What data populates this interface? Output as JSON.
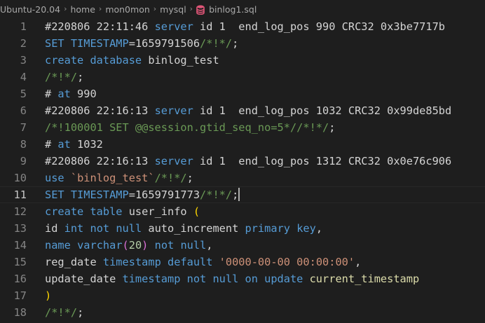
{
  "breadcrumb": {
    "items": [
      "Ubuntu-20.04",
      "home",
      "mon0mon",
      "mysql"
    ],
    "separator": "›",
    "file": "binlog1.sql",
    "file_icon": "database-icon"
  },
  "editor": {
    "current_line": 11,
    "lines": [
      {
        "number": "1",
        "tokens": [
          {
            "t": "#220806 22:11:46 ",
            "c": "plain"
          },
          {
            "t": "server",
            "c": "keyword"
          },
          {
            "t": " id 1  end_log_pos 990 CRC32 0x3be7717b",
            "c": "plain"
          }
        ]
      },
      {
        "number": "2",
        "tokens": [
          {
            "t": "SET TIMESTAMP",
            "c": "keyword"
          },
          {
            "t": "=1659791506",
            "c": "plain"
          },
          {
            "t": "/*!*/",
            "c": "comment"
          },
          {
            "t": ";",
            "c": "plain"
          }
        ]
      },
      {
        "number": "3",
        "tokens": [
          {
            "t": "create database",
            "c": "keyword"
          },
          {
            "t": " binlog_test",
            "c": "plain"
          }
        ]
      },
      {
        "number": "4",
        "tokens": [
          {
            "t": "/*!*/",
            "c": "comment"
          },
          {
            "t": ";",
            "c": "plain"
          }
        ]
      },
      {
        "number": "5",
        "tokens": [
          {
            "t": "# ",
            "c": "plain"
          },
          {
            "t": "at",
            "c": "keyword"
          },
          {
            "t": " 990",
            "c": "plain"
          }
        ]
      },
      {
        "number": "6",
        "tokens": [
          {
            "t": "#220806 22:16:13 ",
            "c": "plain"
          },
          {
            "t": "server",
            "c": "keyword"
          },
          {
            "t": " id 1  end_log_pos 1032 CRC32 0x99de85bd",
            "c": "plain"
          }
        ]
      },
      {
        "number": "7",
        "tokens": [
          {
            "t": "/*!100001 SET @@session.gtid_seq_no=5*//*!*/",
            "c": "comment"
          },
          {
            "t": ";",
            "c": "plain"
          }
        ]
      },
      {
        "number": "8",
        "tokens": [
          {
            "t": "# ",
            "c": "plain"
          },
          {
            "t": "at",
            "c": "keyword"
          },
          {
            "t": " 1032",
            "c": "plain"
          }
        ]
      },
      {
        "number": "9",
        "tokens": [
          {
            "t": "#220806 22:16:13 ",
            "c": "plain"
          },
          {
            "t": "server",
            "c": "keyword"
          },
          {
            "t": " id 1  end_log_pos 1312 CRC32 0x0e76c906",
            "c": "plain"
          }
        ]
      },
      {
        "number": "10",
        "tokens": [
          {
            "t": "use",
            "c": "keyword"
          },
          {
            "t": " ",
            "c": "plain"
          },
          {
            "t": "`binlog_test`",
            "c": "string"
          },
          {
            "t": "/*!*/",
            "c": "comment"
          },
          {
            "t": ";",
            "c": "plain"
          }
        ]
      },
      {
        "number": "11",
        "tokens": [
          {
            "t": "SET TIMESTAMP",
            "c": "keyword"
          },
          {
            "t": "=1659791773",
            "c": "plain"
          },
          {
            "t": "/*!*/",
            "c": "comment"
          },
          {
            "t": ";",
            "c": "plain"
          }
        ]
      },
      {
        "number": "12",
        "tokens": [
          {
            "t": "create table",
            "c": "keyword"
          },
          {
            "t": " user_info ",
            "c": "plain"
          },
          {
            "t": "(",
            "c": "paren2"
          }
        ]
      },
      {
        "number": "13",
        "tokens": [
          {
            "t": "id ",
            "c": "plain"
          },
          {
            "t": "int not null",
            "c": "keyword"
          },
          {
            "t": " auto_increment ",
            "c": "plain"
          },
          {
            "t": "primary key",
            "c": "keyword"
          },
          {
            "t": ",",
            "c": "plain"
          }
        ]
      },
      {
        "number": "14",
        "tokens": [
          {
            "t": "name",
            "c": "keyword"
          },
          {
            "t": " ",
            "c": "plain"
          },
          {
            "t": "varchar",
            "c": "keyword"
          },
          {
            "t": "(",
            "c": "paren"
          },
          {
            "t": "20",
            "c": "number"
          },
          {
            "t": ")",
            "c": "paren"
          },
          {
            "t": " ",
            "c": "plain"
          },
          {
            "t": "not null",
            "c": "keyword"
          },
          {
            "t": ",",
            "c": "plain"
          }
        ]
      },
      {
        "number": "15",
        "tokens": [
          {
            "t": "reg_date ",
            "c": "plain"
          },
          {
            "t": "timestamp default",
            "c": "keyword"
          },
          {
            "t": " ",
            "c": "plain"
          },
          {
            "t": "'0000-00-00 00:00:00'",
            "c": "string"
          },
          {
            "t": ",",
            "c": "plain"
          }
        ]
      },
      {
        "number": "16",
        "tokens": [
          {
            "t": "update_date ",
            "c": "plain"
          },
          {
            "t": "timestamp not null on update",
            "c": "keyword"
          },
          {
            "t": " current_timestamp",
            "c": "func"
          }
        ]
      },
      {
        "number": "17",
        "tokens": [
          {
            "t": ")",
            "c": "paren2"
          }
        ]
      },
      {
        "number": "18",
        "tokens": [
          {
            "t": "/*!*/",
            "c": "comment"
          },
          {
            "t": ";",
            "c": "plain"
          }
        ]
      }
    ]
  }
}
